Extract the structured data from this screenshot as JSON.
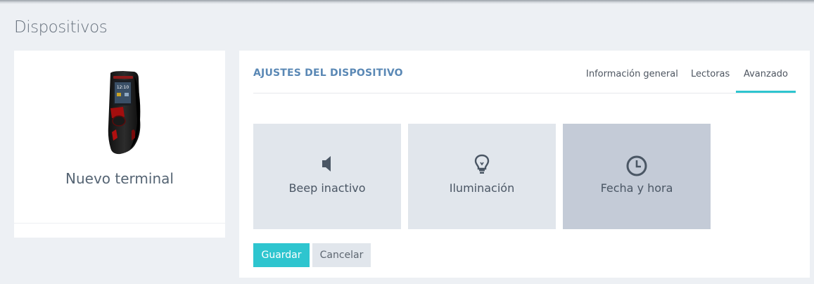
{
  "page": {
    "title": "Dispositivos"
  },
  "device": {
    "name": "Nuevo terminal",
    "screen_time": "12:10"
  },
  "settings": {
    "title": "AJUSTES DEL DISPOSITIVO",
    "tabs": [
      {
        "label": "Información general",
        "active": false
      },
      {
        "label": "Lectoras",
        "active": false
      },
      {
        "label": "Avanzado",
        "active": true
      }
    ],
    "options": [
      {
        "label": "Beep inactivo",
        "icon": "speaker-icon",
        "selected": false
      },
      {
        "label": "Iluminación",
        "icon": "lightbulb-icon",
        "selected": false
      },
      {
        "label": "Fecha y hora",
        "icon": "clock-icon",
        "selected": true
      }
    ],
    "buttons": {
      "save": "Guardar",
      "cancel": "Cancelar"
    }
  },
  "colors": {
    "accent": "#2ec5cf",
    "title_blue": "#5a88b5",
    "tile": "#e1e6ec",
    "tile_selected": "#c4cbd7"
  }
}
